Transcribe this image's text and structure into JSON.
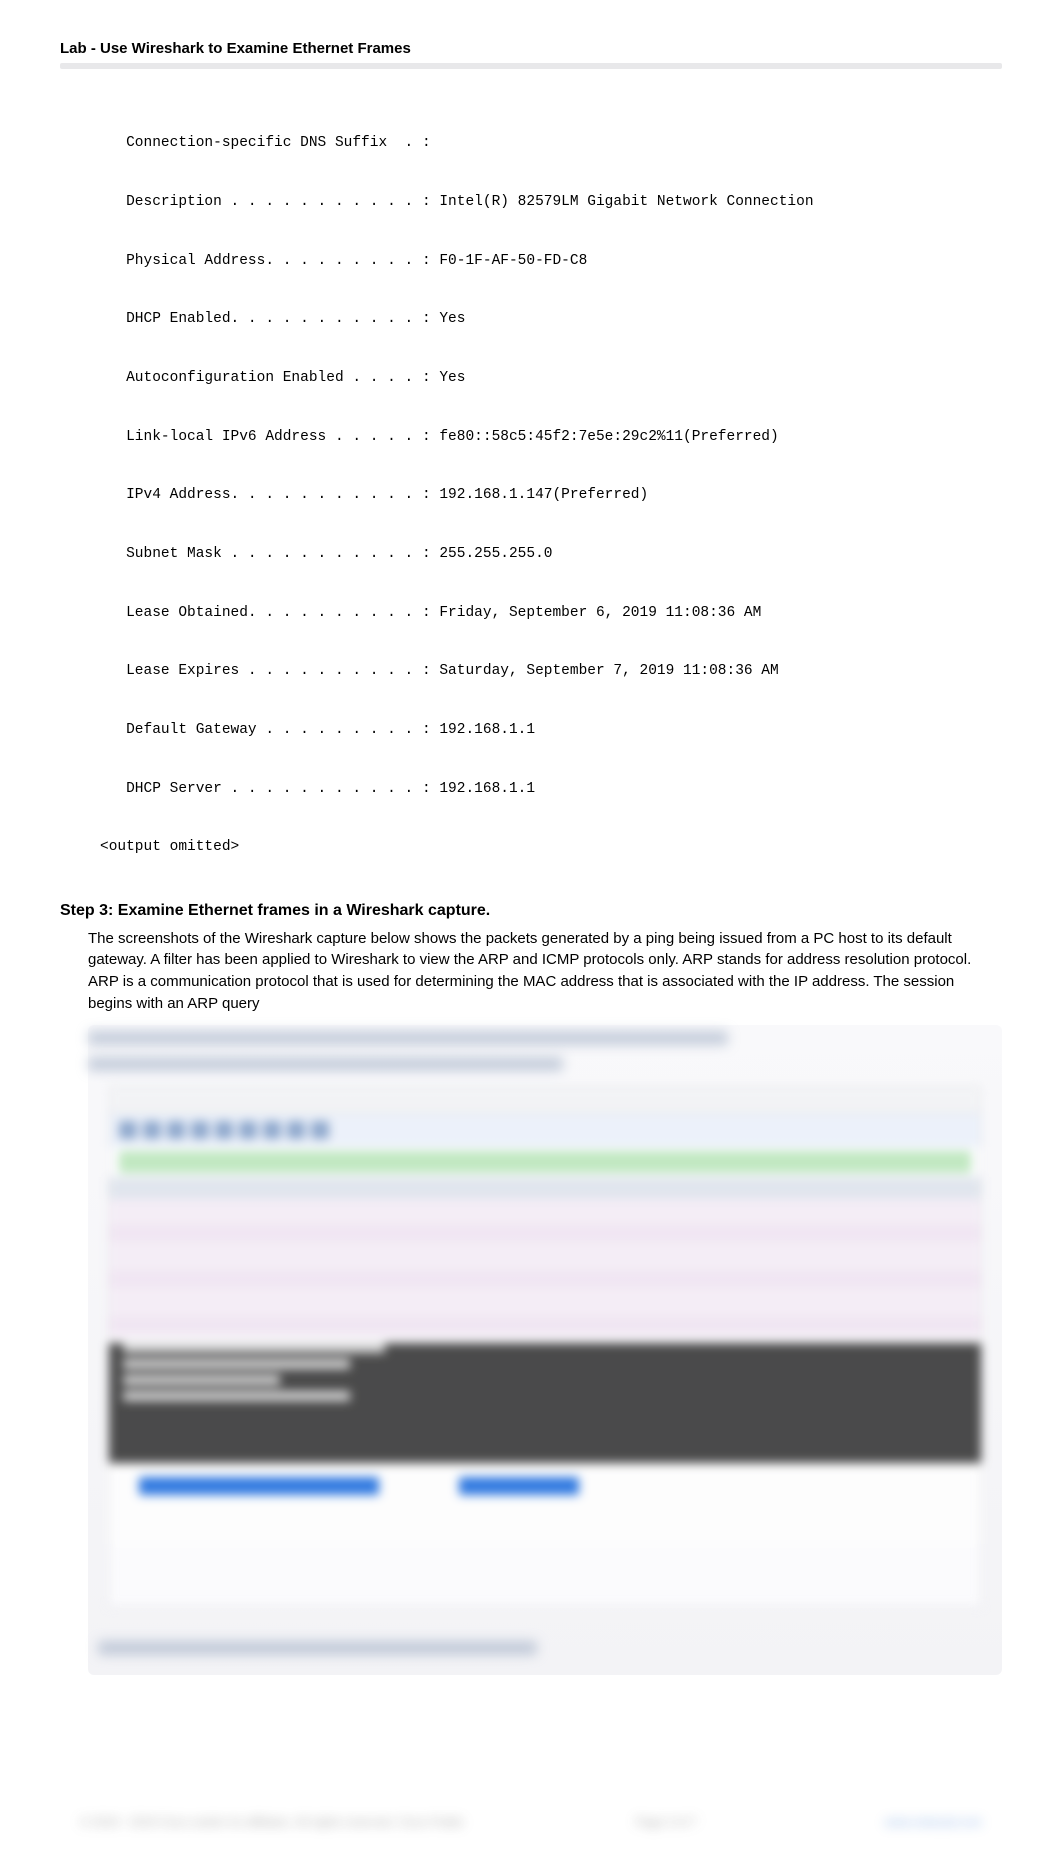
{
  "header": {
    "title": "Lab - Use Wireshark to Examine Ethernet Frames"
  },
  "console_lines": [
    "   Connection-specific DNS Suffix  . :",
    "   Description . . . . . . . . . . . : Intel(R) 82579LM Gigabit Network Connection",
    "   Physical Address. . . . . . . . . : F0-1F-AF-50-FD-C8",
    "   DHCP Enabled. . . . . . . . . . . : Yes",
    "   Autoconfiguration Enabled . . . . : Yes",
    "   Link-local IPv6 Address . . . . . : fe80::58c5:45f2:7e5e:29c2%11(Preferred)",
    "   IPv4 Address. . . . . . . . . . . : 192.168.1.147(Preferred)",
    "   Subnet Mask . . . . . . . . . . . : 255.255.255.0",
    "   Lease Obtained. . . . . . . . . . : Friday, September 6, 2019 11:08:36 AM",
    "   Lease Expires . . . . . . . . . . : Saturday, September 7, 2019 11:08:36 AM",
    "   Default Gateway . . . . . . . . . : 192.168.1.1",
    "   DHCP Server . . . . . . . . . . . : 192.168.1.1",
    "<output omitted>"
  ],
  "step3": {
    "heading": "Step 3: Examine Ethernet frames in a Wireshark capture.",
    "paragraph": "The screenshots of the Wireshark capture below shows the packets generated by a ping being issued from a PC host to its default gateway. A filter has been applied to Wireshark to view the ARP and ICMP protocols only. ARP stands for address resolution protocol. ARP is a communication protocol that is used for determining the MAC address that is associated with the IP address. The session begins with an ARP query"
  },
  "footer": {
    "left": "© 2019 - 2019 Cisco and/or its affiliates. All rights reserved. Cisco Public",
    "center": "Page 3 of 7",
    "right": "www.netacad.com"
  }
}
